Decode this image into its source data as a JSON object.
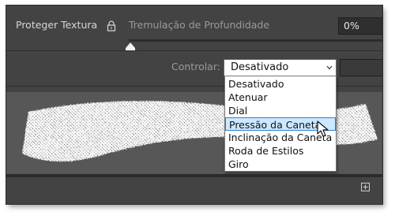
{
  "panel": {
    "protect_texture_label": "Proteger Textura",
    "depth_jitter_label": "Tremulação de Profundidade",
    "depth_jitter_value": "0%",
    "control_label": "Controlar:",
    "control_selected": "Desativado"
  },
  "dropdown": {
    "options": [
      "Desativado",
      "Atenuar",
      "Dial",
      "Pressão da Caneta",
      "Inclinação da Caneta",
      "Roda de Estilos",
      "Giro"
    ],
    "highlighted_index": 3
  },
  "icons": {
    "lock": "lock-icon",
    "chevron": "chevron-down-icon",
    "slider": "slider-knob-icon",
    "new": "add-icon",
    "cursor": "mouse-cursor-icon"
  },
  "colors": {
    "panel_bg": "#434343",
    "preview_bg": "#575757",
    "highlight_bg": "#cce8ff",
    "highlight_border": "#2d7fd3"
  }
}
